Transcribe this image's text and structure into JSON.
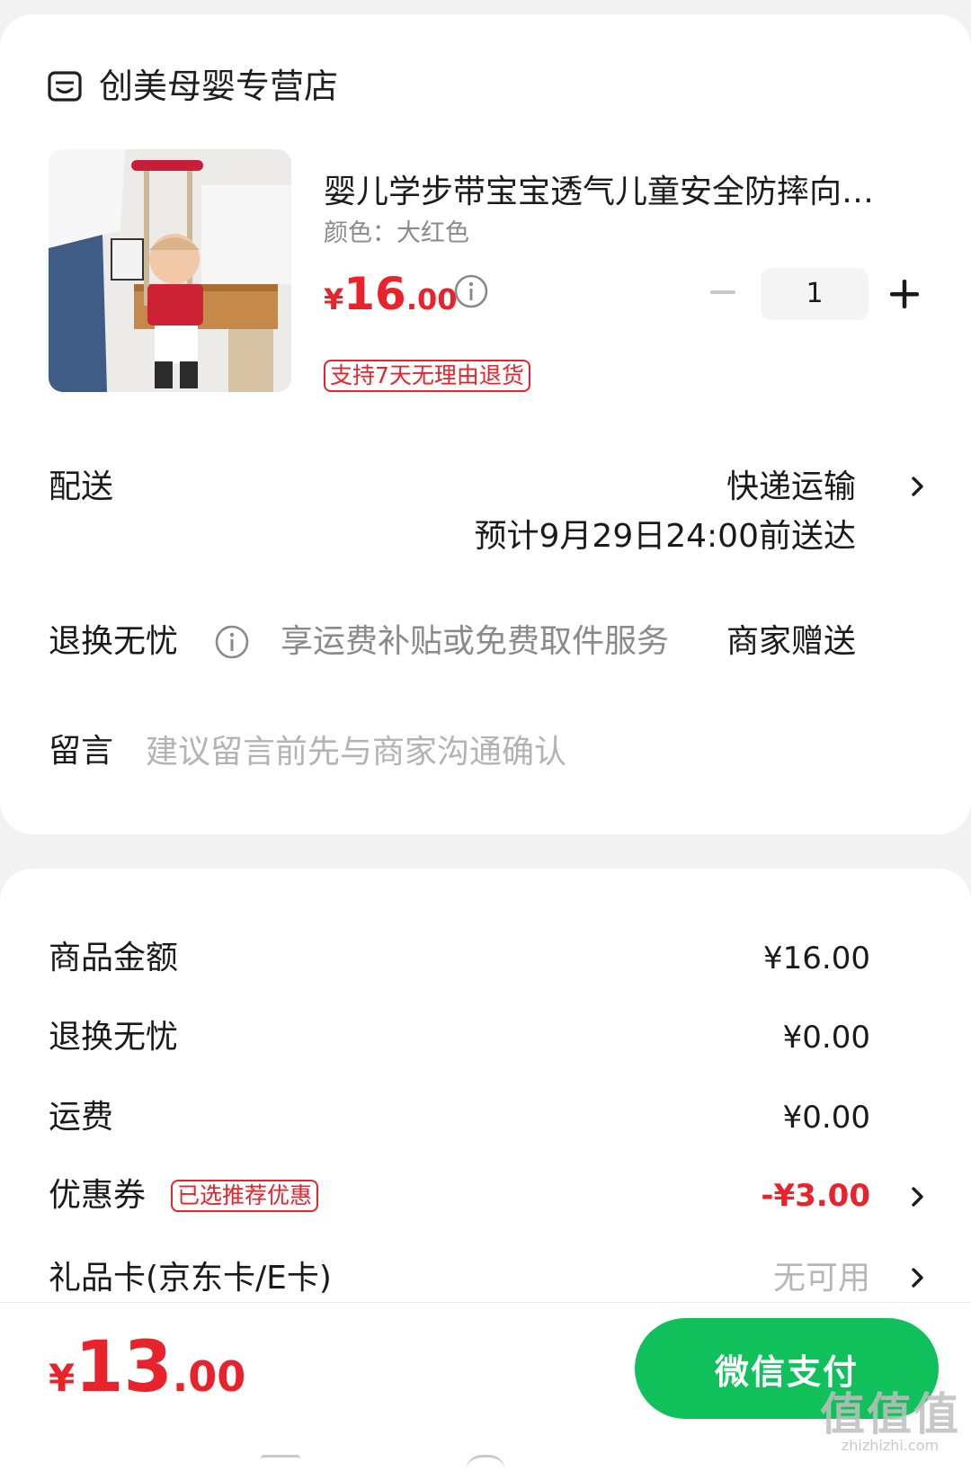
{
  "store": {
    "name": "创美母婴专营店",
    "icon": "store-icon"
  },
  "product": {
    "title": "婴儿学步带宝宝透气儿童安全防摔向…",
    "spec_label": "颜色",
    "spec_sep": "：",
    "spec_value": "大红色",
    "price_symbol": "¥",
    "price_integer": "16",
    "price_decimal": ".00",
    "quantity": "1",
    "return_tag": "支持7天无理由退货"
  },
  "delivery": {
    "label": "配送",
    "method": "快递运输",
    "eta": "预计9月29日24:00前送达"
  },
  "return_service": {
    "label": "退换无忧",
    "description": "享运费补贴或免费取件服务",
    "value": "商家赠送"
  },
  "note": {
    "label": "留言",
    "placeholder": "建议留言前先与商家沟通确认"
  },
  "summary": {
    "goods_label": "商品金额",
    "goods_value": "¥16.00",
    "return_label": "退换无忧",
    "return_value": "¥0.00",
    "shipping_label": "运费",
    "shipping_value": "¥0.00",
    "coupon_label": "优惠券",
    "coupon_tag": "已选推荐优惠",
    "coupon_value": "-¥3.00",
    "giftcard_label": "礼品卡(京东卡/E卡)",
    "giftcard_value": "无可用"
  },
  "footer": {
    "total_symbol": "¥",
    "total_integer": "13",
    "total_decimal": ".00",
    "pay_button": "微信支付",
    "watermark": "值值值",
    "watermark_url": "zhizhizhi.com"
  },
  "colors": {
    "accent_red": "#e8232c",
    "pay_green": "#10c15b",
    "muted_text": "#8a8a8a"
  }
}
